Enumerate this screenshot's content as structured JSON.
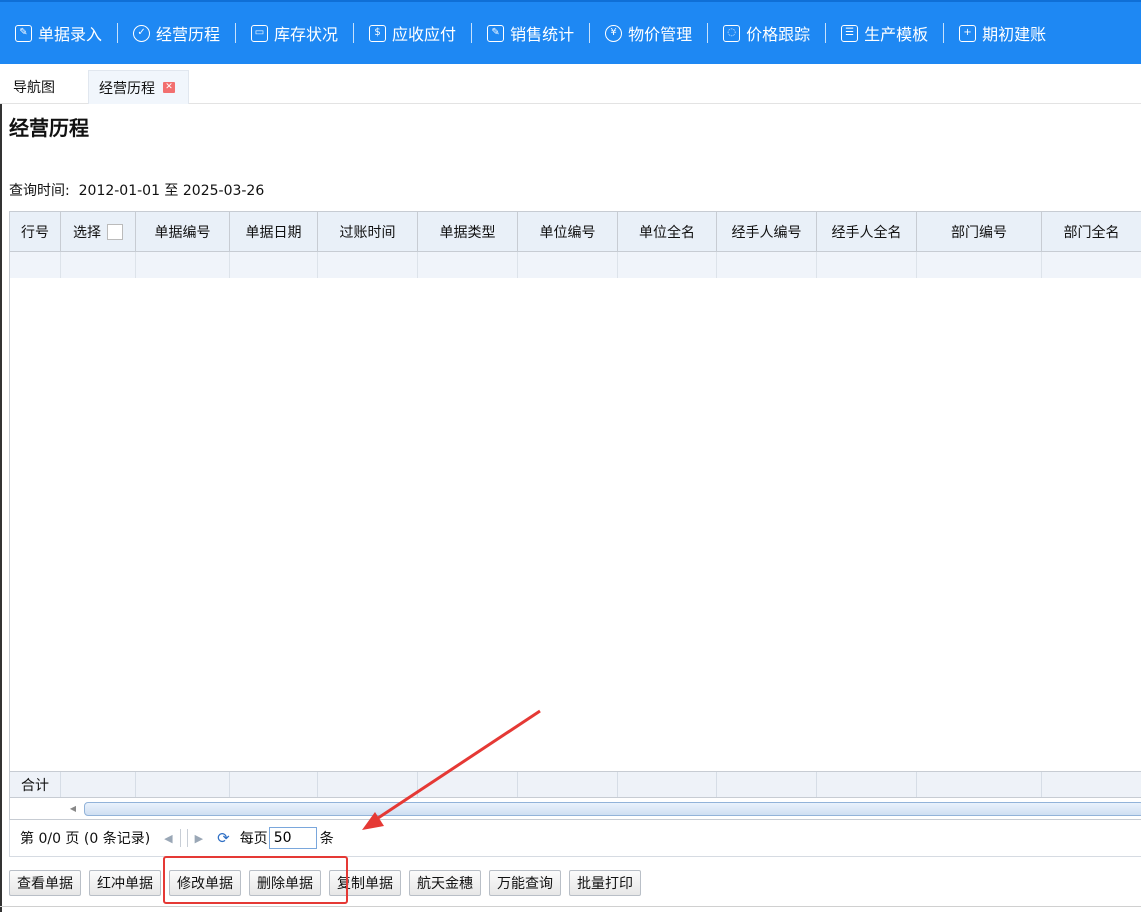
{
  "nav": {
    "items": [
      {
        "label": "单据录入",
        "icon": "edit-icon",
        "glyph": "✎"
      },
      {
        "label": "经营历程",
        "icon": "check-circle-icon",
        "glyph": "✓"
      },
      {
        "label": "库存状况",
        "icon": "box-icon",
        "glyph": "▭"
      },
      {
        "label": "应收应付",
        "icon": "money-box-icon",
        "glyph": "$"
      },
      {
        "label": "销售统计",
        "icon": "chart-edit-icon",
        "glyph": "✎"
      },
      {
        "label": "物价管理",
        "icon": "yen-circle-icon",
        "glyph": "¥"
      },
      {
        "label": "价格跟踪",
        "icon": "track-icon",
        "glyph": "◌"
      },
      {
        "label": "生产模板",
        "icon": "template-icon",
        "glyph": "☰"
      },
      {
        "label": "期初建账",
        "icon": "plus-doc-icon",
        "glyph": "+"
      }
    ]
  },
  "tabs": {
    "nav_label": "导航图",
    "active_label": "经营历程",
    "close_glyph": "✕"
  },
  "page": {
    "title": "经营历程",
    "query_label": "查询时间:",
    "query_value": "2012-01-01 至 2025-03-26"
  },
  "grid": {
    "columns": [
      "行号",
      "选择",
      "单据编号",
      "单据日期",
      "过账时间",
      "单据类型",
      "单位编号",
      "单位全名",
      "经手人编号",
      "经手人全名",
      "部门编号",
      "部门全名"
    ],
    "total_label": "合计",
    "scroll_left_glyph": "◀"
  },
  "pager": {
    "page_info": "第 0/0 页 (0 条记录)",
    "prev_glyph": "◀",
    "next_glyph": "▶",
    "refresh_glyph": "⟳",
    "per_page_label": "每页",
    "per_page_value": "50",
    "unit_label": "条"
  },
  "actions": [
    "查看单据",
    "红冲单据",
    "修改单据",
    "删除单据",
    "复制单据",
    "航天金穗",
    "万能查询",
    "批量打印"
  ],
  "colors": {
    "nav_bg": "#1e88f3",
    "highlight": "#e53935",
    "grid_header": "#e9f0f8"
  }
}
